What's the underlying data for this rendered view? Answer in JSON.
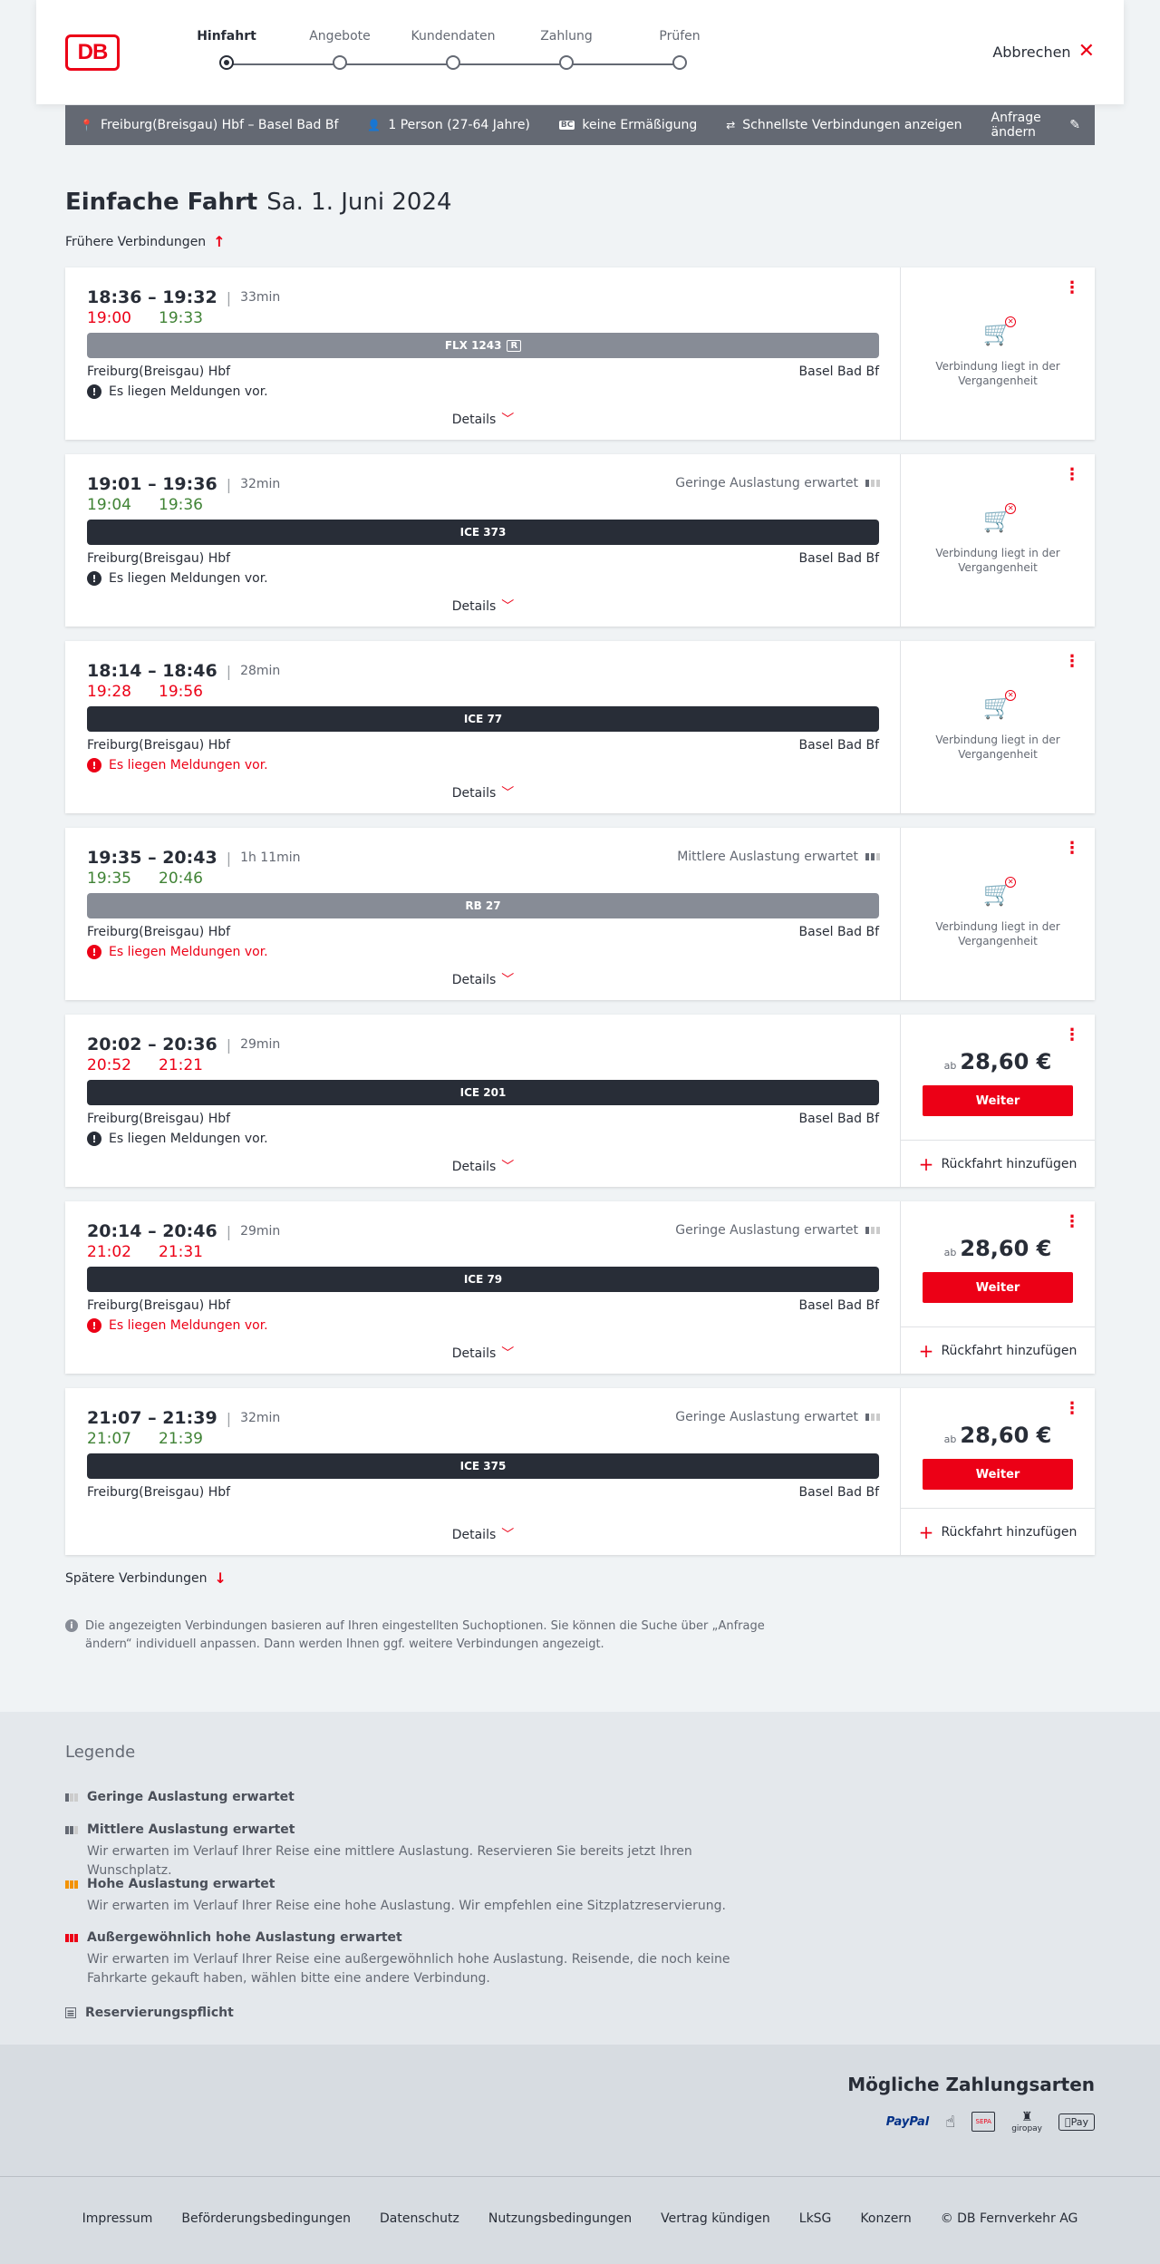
{
  "header": {
    "logo": "DB",
    "steps": [
      {
        "label": "Hinfahrt",
        "active": true
      },
      {
        "label": "Angebote",
        "active": false
      },
      {
        "label": "Kundendaten",
        "active": false
      },
      {
        "label": "Zahlung",
        "active": false
      },
      {
        "label": "Prüfen",
        "active": false
      }
    ],
    "cancel_label": "Abbrechen"
  },
  "query": {
    "route": "Freiburg(Breisgau) Hbf – Basel Bad Bf",
    "persons": "1 Person (27-64 Jahre)",
    "discount_badge": "BC",
    "discount": "keine Ermäßigung",
    "fastest": "Schnellste Verbindungen anzeigen",
    "change": "Anfrage ändern"
  },
  "title": {
    "type": "Einfache Fahrt",
    "date": "Sa. 1. Juni 2024"
  },
  "earlier_label": "Frühere Verbindungen",
  "later_label": "Spätere Verbindungen",
  "common": {
    "details": "Details",
    "past_line1": "Verbindung liegt in der",
    "past_line2": "Vergangenheit",
    "weiter": "Weiter",
    "return": "Rückfahrt hinzufügen",
    "ab": "ab"
  },
  "connections": [
    {
      "sched": "18:36 – 19:32",
      "dur": "33min",
      "rt_dep": "19:00",
      "rt_dep_late": true,
      "rt_arr": "19:33",
      "rt_arr_late": false,
      "occupancy": "",
      "train": "FLX 1243",
      "train_badge": "R",
      "bar": "grey",
      "from": "Freiburg(Breisgau) Hbf",
      "to": "Basel Bad Bf",
      "message": "Es liegen Meldungen vor.",
      "msg_red": false,
      "past": true,
      "price": ""
    },
    {
      "sched": "19:01 – 19:36",
      "dur": "32min",
      "rt_dep": "19:04",
      "rt_dep_late": false,
      "rt_arr": "19:36",
      "rt_arr_late": false,
      "occupancy": "Geringe Auslastung erwartet",
      "occ_level": 1,
      "train": "ICE 373",
      "train_badge": "",
      "bar": "dark",
      "from": "Freiburg(Breisgau) Hbf",
      "to": "Basel Bad Bf",
      "message": "Es liegen Meldungen vor.",
      "msg_red": false,
      "past": true,
      "price": ""
    },
    {
      "sched": "18:14 – 18:46",
      "dur": "28min",
      "rt_dep": "19:28",
      "rt_dep_late": true,
      "rt_arr": "19:56",
      "rt_arr_late": true,
      "occupancy": "",
      "train": "ICE 77",
      "train_badge": "",
      "bar": "dark",
      "from": "Freiburg(Breisgau) Hbf",
      "to": "Basel Bad Bf",
      "message": "Es liegen Meldungen vor.",
      "msg_red": true,
      "past": true,
      "price": ""
    },
    {
      "sched": "19:35 – 20:43",
      "dur": "1h 11min",
      "rt_dep": "19:35",
      "rt_dep_late": false,
      "rt_arr": "20:46",
      "rt_arr_late": false,
      "occupancy": "Mittlere Auslastung erwartet",
      "occ_level": 2,
      "train": "RB 27",
      "train_badge": "",
      "bar": "grey",
      "from": "Freiburg(Breisgau) Hbf",
      "to": "Basel Bad Bf",
      "message": "Es liegen Meldungen vor.",
      "msg_red": true,
      "past": true,
      "price": ""
    },
    {
      "sched": "20:02 – 20:36",
      "dur": "29min",
      "rt_dep": "20:52",
      "rt_dep_late": true,
      "rt_arr": "21:21",
      "rt_arr_late": true,
      "occupancy": "",
      "train": "ICE 201",
      "train_badge": "",
      "bar": "dark",
      "from": "Freiburg(Breisgau) Hbf",
      "to": "Basel Bad Bf",
      "message": "Es liegen Meldungen vor.",
      "msg_red": false,
      "past": false,
      "price": "28,60 €"
    },
    {
      "sched": "20:14 – 20:46",
      "dur": "29min",
      "rt_dep": "21:02",
      "rt_dep_late": true,
      "rt_arr": "21:31",
      "rt_arr_late": true,
      "occupancy": "Geringe Auslastung erwartet",
      "occ_level": 1,
      "train": "ICE 79",
      "train_badge": "",
      "bar": "dark",
      "from": "Freiburg(Breisgau) Hbf",
      "to": "Basel Bad Bf",
      "message": "Es liegen Meldungen vor.",
      "msg_red": true,
      "past": false,
      "price": "28,60 €"
    },
    {
      "sched": "21:07 – 21:39",
      "dur": "32min",
      "rt_dep": "21:07",
      "rt_dep_late": false,
      "rt_arr": "21:39",
      "rt_arr_late": false,
      "occupancy": "Geringe Auslastung erwartet",
      "occ_level": 1,
      "train": "ICE 375",
      "train_badge": "",
      "bar": "dark",
      "from": "Freiburg(Breisgau) Hbf",
      "to": "Basel Bad Bf",
      "message": "",
      "msg_red": false,
      "past": false,
      "price": "28,60 €"
    }
  ],
  "note": "Die angezeigten Verbindungen basieren auf Ihren eingestellten Suchoptionen. Sie können die Suche über „Anfrage ändern“ individuell anpassen. Dann werden Ihnen ggf. weitere Verbindungen angezeigt.",
  "legend": {
    "title": "Legende",
    "items": [
      {
        "title": "Geringe Auslastung erwartet",
        "desc": "",
        "icon": "occupancy-low-icon"
      },
      {
        "title": "Mittlere Auslastung erwartet",
        "desc": "Wir erwarten im Verlauf Ihrer Reise eine mittlere Auslastung. Reservieren Sie bereits jetzt Ihren Wunschplatz.",
        "icon": "occupancy-medium-icon"
      },
      {
        "title": "Hohe Auslastung erwartet",
        "desc": "Wir erwarten im Verlauf Ihrer Reise eine hohe Auslastung. Wir empfehlen eine Sitzplatzreservierung.",
        "icon": "occupancy-high-icon"
      },
      {
        "title": "Außergewöhnlich hohe Auslastung erwartet",
        "desc": "Wir erwarten im Verlauf Ihrer Reise eine außergewöhnlich hohe Auslastung. Reisende, die noch keine Fahrkarte gekauft haben, wählen bitte eine andere Verbindung.",
        "icon": "occupancy-extreme-icon"
      },
      {
        "title": "Reservierungspflicht",
        "desc": "",
        "icon": "reservation-icon"
      }
    ]
  },
  "payment": {
    "title": "Mögliche Zahlungsarten",
    "methods": [
      "PayPal",
      "SEPA",
      "giropay",
      "Pay"
    ]
  },
  "footer": {
    "links": [
      "Impressum",
      "Beförderungsbedingungen",
      "Datenschutz",
      "Nutzungsbedingungen",
      "Vertrag kündigen",
      "LkSG",
      "Konzern",
      "© DB Fernverkehr AG"
    ]
  },
  "colors": {
    "brand_red": "#ec0016",
    "late_red": "#ec0016",
    "ontime_green": "#408335",
    "bar_dark": "#282d37",
    "bar_grey": "#878c96"
  }
}
